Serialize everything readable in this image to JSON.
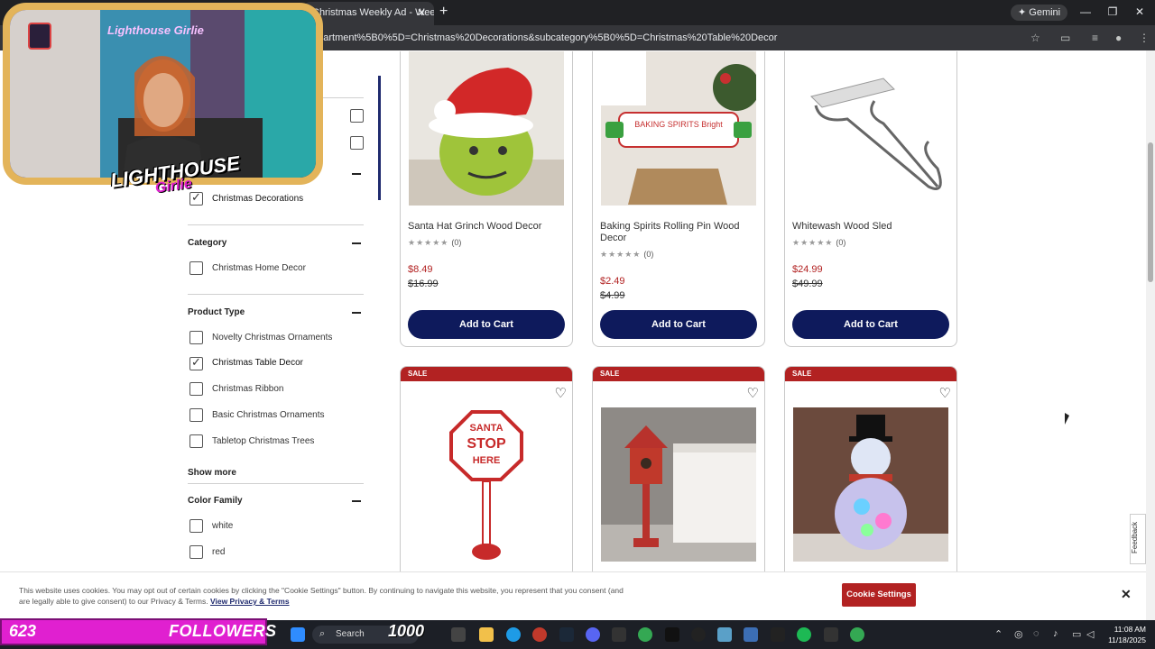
{
  "browser": {
    "tab_title": "Christmas Weekly Ad - Weekly",
    "tab_close": "✕",
    "new_tab": "+",
    "gemini_label": "Gemini",
    "url": "epartment%5B0%5D=Christmas%20Decorations&subcategory%5B0%5D=Christmas%20Table%20Decor",
    "window_minimize": "—",
    "window_restore": "❐",
    "window_close": "✕"
  },
  "stream": {
    "cam_title": "Lighthouse Girlie",
    "cam_logo_top": "LIGHTHOUSE",
    "cam_logo_bottom": "Girlie",
    "followers_count": "623",
    "followers_label": "FOLLOWERS",
    "followers_goal": "1000"
  },
  "filters": {
    "department_selected": "Christmas Decorations",
    "category": {
      "heading": "Category",
      "options": [
        "Christmas Home Decor"
      ]
    },
    "product_type": {
      "heading": "Product Type",
      "options": [
        {
          "label": "Novelty Christmas Ornaments",
          "checked": false
        },
        {
          "label": "Christmas Table Decor",
          "checked": true
        },
        {
          "label": "Christmas Ribbon",
          "checked": false
        },
        {
          "label": "Basic Christmas Ornaments",
          "checked": false
        },
        {
          "label": "Tabletop Christmas Trees",
          "checked": false
        }
      ]
    },
    "show_more": "Show more",
    "color_family": {
      "heading": "Color Family",
      "options": [
        "white",
        "red"
      ]
    }
  },
  "products_top": [
    {
      "name": "Santa Hat Grinch Wood Decor",
      "stars": "★★★★★",
      "reviews": "(0)",
      "price": "$8.49",
      "old_price": "$16.99",
      "button": "Add to Cart"
    },
    {
      "name": "Baking Spirits Rolling Pin Wood Decor",
      "stars": "★★★★★",
      "reviews": "(0)",
      "price": "$2.49",
      "old_price": "$4.99",
      "button": "Add to Cart"
    },
    {
      "name": "Whitewash Wood Sled",
      "stars": "★★★★★",
      "reviews": "(0)",
      "price": "$24.99",
      "old_price": "$49.99",
      "button": "Add to Cart"
    }
  ],
  "products_bottom": [
    {
      "badge": "SALE"
    },
    {
      "badge": "SALE"
    },
    {
      "badge": "SALE"
    }
  ],
  "product_image_text": {
    "grinch_sign": "BAKING SPIRITS Bright",
    "stop_sign_line1": "SANTA",
    "stop_sign_line2": "STOP",
    "stop_sign_line3": "HERE"
  },
  "feedback": "Feedback",
  "cookie": {
    "text": "This website uses cookies. You may opt out of certain cookies by clicking the \"Cookie Settings\" button. By continuing to navigate this website, you represent that you consent (and are legally able to give consent) to our Privacy & Terms.",
    "link": "View Privacy & Terms",
    "button": "Cookie Settings",
    "close": "✕"
  },
  "taskbar": {
    "search": "Search",
    "time": "11:08 AM",
    "date": "11/18/2025"
  },
  "colors": {
    "navy_button": "#0e1a5c",
    "sale_red": "#b22222",
    "followers_magenta": "#e020d0",
    "cam_frame_gold": "#e3b45a"
  }
}
